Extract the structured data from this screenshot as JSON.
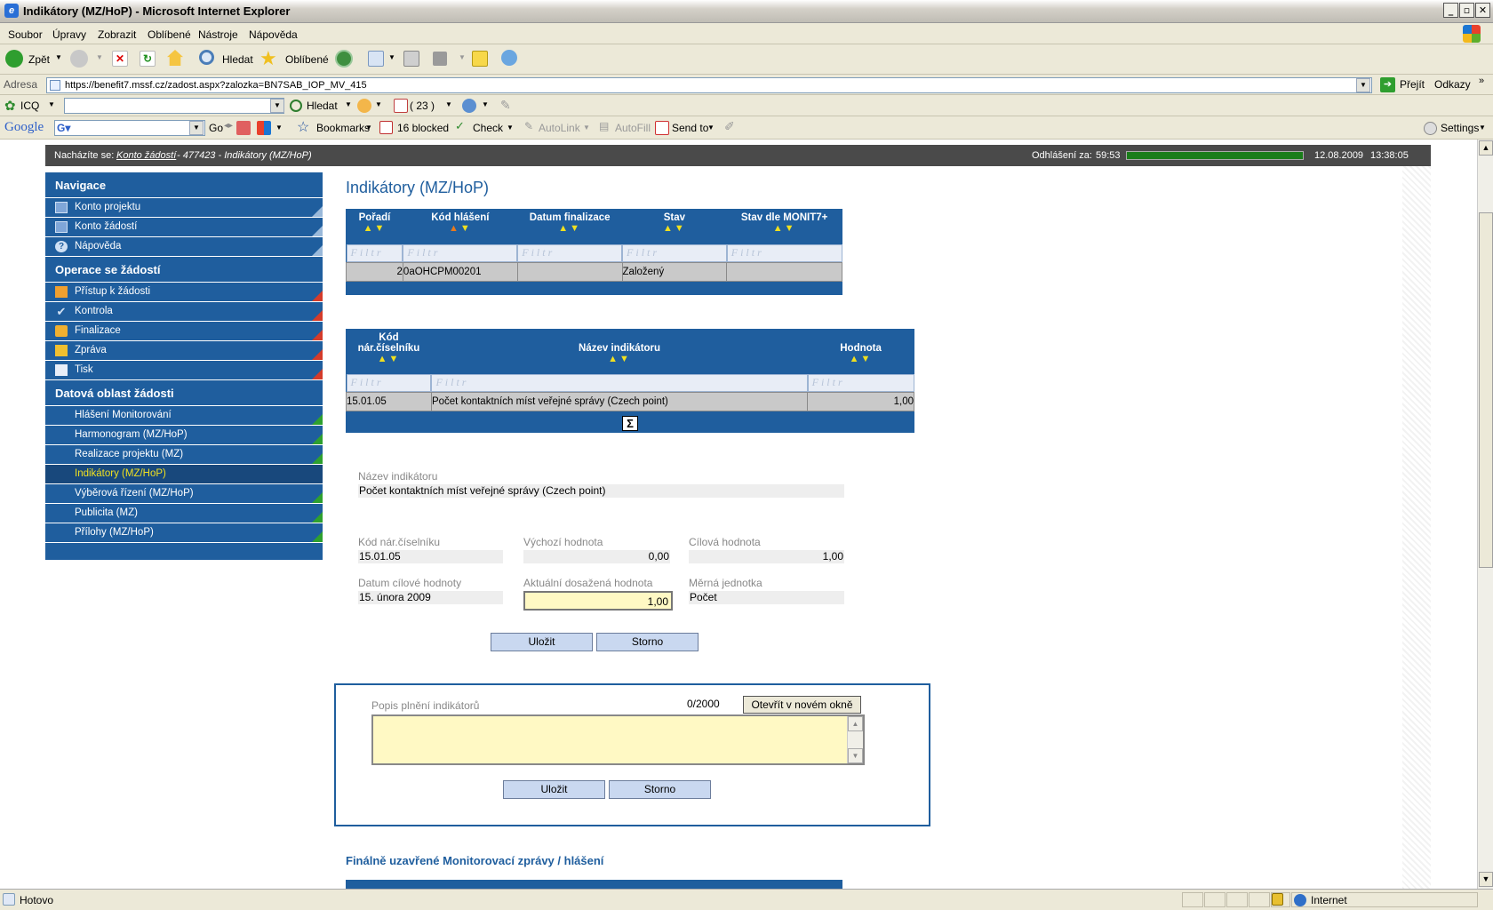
{
  "window": {
    "title": "Indikátory (MZ/HoP) - Microsoft Internet Explorer"
  },
  "menu": [
    "Soubor",
    "Úpravy",
    "Zobrazit",
    "Oblíbené",
    "Nástroje",
    "Nápověda"
  ],
  "toolbar": {
    "back": "Zpět",
    "search": "Hledat",
    "favorites": "Oblíbené"
  },
  "address": {
    "label": "Adresa",
    "url": "https://benefit7.mssf.cz/zadost.aspx?zalozka=BN7SAB_IOP_MV_415",
    "go": "Přejít",
    "links": "Odkazy"
  },
  "icqbar": {
    "icq": "ICQ",
    "search": "Hledat",
    "count": "( 23 )"
  },
  "googlebar": {
    "logo": "Google",
    "go": "Go",
    "bookmarks": "Bookmarks",
    "blocked": "16 blocked",
    "check": "Check",
    "autolink": "AutoLink",
    "autofill": "AutoFill",
    "sendto": "Send to",
    "settings": "Settings"
  },
  "header": {
    "breadcrumb_prefix": "Nacházíte se:",
    "breadcrumb_link": "Konto žádostí",
    "breadcrumb_rest": "- 477423 - Indikátory (MZ/HoP)",
    "logout_label": "Odhlášení za:",
    "logout_time": "59:53",
    "date": "12.08.2009",
    "time": "13:38:05"
  },
  "sidebar": {
    "sections": [
      {
        "title": "Navigace",
        "items": [
          "Konto projektu",
          "Konto žádostí",
          "Nápověda"
        ]
      },
      {
        "title": "Operace se žádostí",
        "items": [
          "Přístup k žádosti",
          "Kontrola",
          "Finalizace",
          "Zpráva",
          "Tisk"
        ]
      },
      {
        "title": "Datová oblast žádosti",
        "items": [
          "Hlášení Monitorování",
          "Harmonogram (MZ/HoP)",
          "Realizace projektu (MZ)",
          "Indikátory (MZ/HoP)",
          "Výběrová řízení (MZ/HoP)",
          "Publicita (MZ)",
          "Přílohy (MZ/HoP)"
        ]
      }
    ],
    "active": "Indikátory (MZ/HoP)"
  },
  "main": {
    "title": "Indikátory (MZ/HoP)",
    "filter_placeholder": "Filtr",
    "reports_table": {
      "columns": [
        "Pořadí",
        "Kód hlášení",
        "Datum finalizace",
        "Stav",
        "Stav dle MONIT7+"
      ],
      "rows": [
        [
          "2",
          "0aOHCPM00201",
          "",
          "Založený",
          ""
        ]
      ]
    },
    "indicators_table": {
      "columns": [
        "Kód nár.číselníku",
        "Název indikátoru",
        "Hodnota"
      ],
      "rows": [
        [
          "15.01.05",
          "Počet kontaktních míst veřejné správy (Czech point)",
          "1,00"
        ]
      ],
      "sum_icon": "Σ"
    },
    "detail": {
      "name_label": "Název indikátoru",
      "name_value": "Počet kontaktních míst veřejné správy (Czech point)",
      "code_label": "Kód nár.číselníku",
      "code_value": "15.01.05",
      "initial_label": "Výchozí hodnota",
      "initial_value": "0,00",
      "target_label": "Cílová hodnota",
      "target_value": "1,00",
      "target_date_label": "Datum cílové hodnoty",
      "target_date_value": "15. února 2009",
      "current_label": "Aktuální dosažená hodnota",
      "current_value": "1,00",
      "unit_label": "Měrná jednotka",
      "unit_value": "Počet",
      "save": "Uložit",
      "cancel": "Storno"
    },
    "description": {
      "label": "Popis plnění indikátorů",
      "counter": "0/2000",
      "open_new": "Otevřít v novém okně",
      "value": "",
      "save": "Uložit",
      "cancel": "Storno"
    },
    "final_section_title": "Finálně uzavřené Monitorovací zprávy / hlášení"
  },
  "status": {
    "text": "Hotovo",
    "zone": "Internet"
  }
}
